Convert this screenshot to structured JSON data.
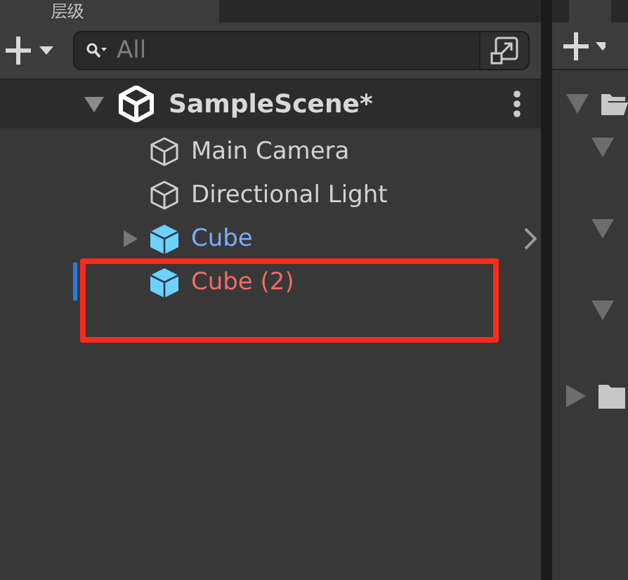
{
  "tab": {
    "title": "层级"
  },
  "search": {
    "placeholder": "All"
  },
  "scene": {
    "name": "SampleScene*",
    "expanded": true
  },
  "objects": [
    {
      "name": "Main Camera",
      "kind": "object",
      "collapsed_children": false,
      "prefab_arrow": false,
      "selected": false
    },
    {
      "name": "Directional Light",
      "kind": "object",
      "collapsed_children": false,
      "prefab_arrow": false,
      "selected": false
    },
    {
      "name": "Cube",
      "kind": "prefab",
      "collapsed_children": true,
      "prefab_arrow": true,
      "selected": false
    },
    {
      "name": "Cube (2)",
      "kind": "missing",
      "collapsed_children": false,
      "prefab_arrow": false,
      "selected": true
    }
  ],
  "annotation": {
    "kind": "rectangle",
    "color": "#ff2a1a"
  }
}
